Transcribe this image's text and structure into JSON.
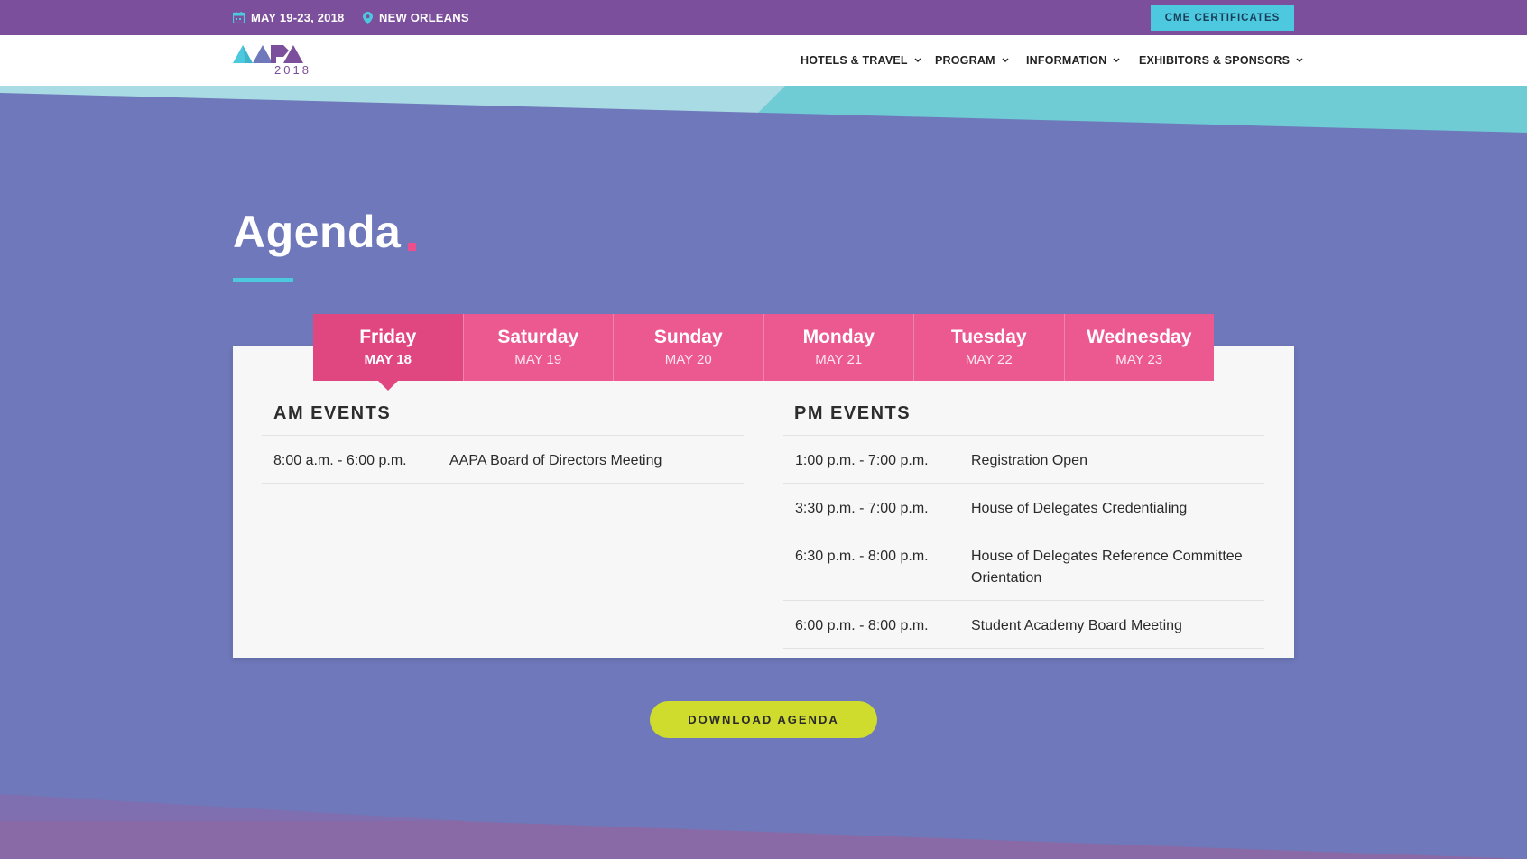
{
  "topbar": {
    "date": "MAY 19-23, 2018",
    "location": "NEW ORLEANS",
    "cme_label": "CME CERTIFICATES"
  },
  "logo": {
    "text": "AAPA",
    "year": "2018"
  },
  "nav": {
    "items": [
      {
        "label": "HOTELS & TRAVEL"
      },
      {
        "label": "PROGRAM"
      },
      {
        "label": "INFORMATION"
      },
      {
        "label": "EXHIBITORS & SPONSORS"
      }
    ]
  },
  "page": {
    "title": "Agenda"
  },
  "tabs": [
    {
      "day": "Friday",
      "date": "MAY 18",
      "active": true
    },
    {
      "day": "Saturday",
      "date": "MAY 19",
      "active": false
    },
    {
      "day": "Sunday",
      "date": "MAY 20",
      "active": false
    },
    {
      "day": "Monday",
      "date": "MAY 21",
      "active": false
    },
    {
      "day": "Tuesday",
      "date": "MAY 22",
      "active": false
    },
    {
      "day": "Wednesday",
      "date": "MAY 23",
      "active": false
    }
  ],
  "am": {
    "title": "AM EVENTS",
    "events": [
      {
        "time": "8:00 a.m. - 6:00 p.m.",
        "name": "AAPA Board of Directors Meeting"
      }
    ]
  },
  "pm": {
    "title": "PM EVENTS",
    "events": [
      {
        "time": "1:00 p.m. - 7:00 p.m.",
        "name": "Registration Open"
      },
      {
        "time": "3:30 p.m. - 7:00 p.m.",
        "name": "House of Delegates Credentialing"
      },
      {
        "time": "6:30 p.m. - 8:00 p.m.",
        "name": "House of Delegates Reference Committee Orientation"
      },
      {
        "time": "6:00 p.m. - 8:00 p.m.",
        "name": "Student Academy Board Meeting"
      }
    ]
  },
  "download": {
    "label": "DOWNLOAD AGENDA"
  },
  "colors": {
    "topbar": "#7b4f9b",
    "background": "#6e78ba",
    "tab": "#ec5990",
    "tab_active": "#e04781",
    "accent_cyan": "#4cc9df",
    "download_button": "#cfdc2e"
  }
}
